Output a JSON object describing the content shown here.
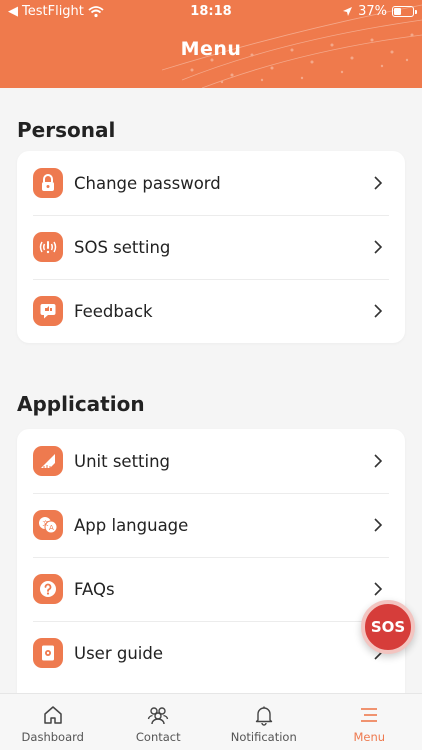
{
  "status_bar": {
    "carrier": "TestFlight",
    "time": "18:18",
    "battery": "37%"
  },
  "header": {
    "title": "Menu"
  },
  "sections": [
    {
      "title": "Personal",
      "items": [
        {
          "label": "Change password",
          "icon": "lock-icon"
        },
        {
          "label": "SOS setting",
          "icon": "alert-signal-icon"
        },
        {
          "label": "Feedback",
          "icon": "feedback-icon"
        }
      ]
    },
    {
      "title": "Application",
      "items": [
        {
          "label": "Unit setting",
          "icon": "ruler-icon"
        },
        {
          "label": "App language",
          "icon": "translate-icon"
        },
        {
          "label": "FAQs",
          "icon": "question-icon"
        },
        {
          "label": "User guide",
          "icon": "guide-book-icon"
        }
      ]
    }
  ],
  "sos_button": {
    "label": "SOS"
  },
  "tabbar": [
    {
      "label": "Dashboard",
      "icon": "home-icon",
      "active": false
    },
    {
      "label": "Contact",
      "icon": "contacts-icon",
      "active": false
    },
    {
      "label": "Notification",
      "icon": "bell-icon",
      "active": false
    },
    {
      "label": "Menu",
      "icon": "menu-icon",
      "active": true
    }
  ],
  "colors": {
    "accent": "#ef7a4c",
    "sos": "#d63d3a",
    "background": "#f5f5f5"
  }
}
